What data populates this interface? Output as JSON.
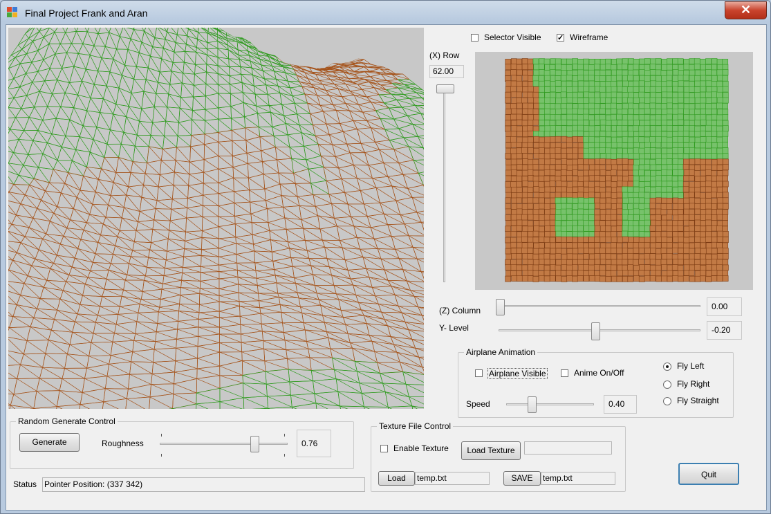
{
  "window": {
    "title": "Final Project Frank and Aran",
    "close_glyph": "✕"
  },
  "view_options": {
    "selector_visible": {
      "label": "Selector Visible",
      "checked": false
    },
    "wireframe": {
      "label": "Wireframe",
      "checked": true
    }
  },
  "row_control": {
    "label": "(X) Row",
    "value": "62.00"
  },
  "column_control": {
    "label": "(Z) Column",
    "value": "0.00"
  },
  "ylevel_control": {
    "label": "Y- Level",
    "value": "-0.20"
  },
  "airplane": {
    "group_label": "Airplane Animation",
    "visible_label": "Airplane Visible",
    "visible_checked": false,
    "anime_label": "Anime On/Off",
    "anime_checked": false,
    "speed_label": "Speed",
    "speed_value": "0.40",
    "fly_options": [
      {
        "label": "Fly Left",
        "selected": true
      },
      {
        "label": "Fly Right",
        "selected": false
      },
      {
        "label": "Fly Straight",
        "selected": false
      }
    ]
  },
  "random_generate": {
    "group_label": "Random Generate Control",
    "generate_label": "Generate",
    "roughness_label": "Roughness",
    "roughness_value": "0.76"
  },
  "texture": {
    "group_label": "Texture File Control",
    "enable_label": "Enable Texture",
    "enable_checked": false,
    "load_texture_label": "Load Texture",
    "texture_path": "",
    "load_label": "Load",
    "load_file": "temp.txt",
    "save_label": "SAVE",
    "save_file": "temp.txt"
  },
  "status": {
    "label": "Status",
    "text": "Pointer Position: (337 342)"
  },
  "quit_label": "Quit",
  "colors": {
    "grass": "#2f9b1f",
    "dirt": "#a5541c",
    "viewport_bg": "#c8c8c8"
  }
}
